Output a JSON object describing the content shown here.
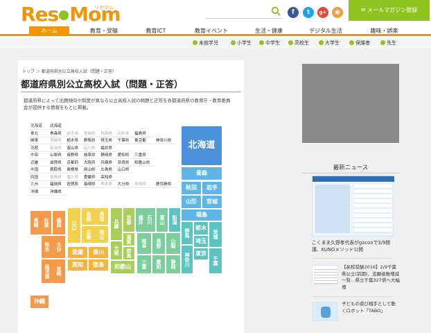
{
  "header": {
    "logo_text": "ResеMom",
    "logo_kana": "リセマム",
    "mail_button": "✉ メールマガジン登録",
    "social": [
      "f",
      "t",
      "g+",
      "rss"
    ]
  },
  "nav": {
    "items": [
      "ホーム",
      "教育・受験",
      "教育ICT",
      "教育イベント",
      "生活・健康",
      "デジタル生活",
      "趣味・娯楽"
    ]
  },
  "subnav": {
    "items": [
      "未就学児",
      "小学生",
      "中学生",
      "高校生",
      "大学生",
      "保護者",
      "先生"
    ]
  },
  "breadcrumb": "トップ ＞ 都道府県別公立高校入試（問題・正答）",
  "page_title": "都道府県別公立高校入試（問題・正答）",
  "description": "都道府県によって出題傾向や制度が異なる公立高校入試の問題と正答を各都道府県の教育庁・教育委員会が提供する情報をもとに掲載。",
  "region_table": [
    {
      "region": "北海道",
      "prefs": [
        {
          "n": "北海道",
          "on": true
        }
      ]
    },
    {
      "region": "東北",
      "prefs": [
        {
          "n": "青森県",
          "on": true
        },
        {
          "n": "岩手県",
          "on": false
        },
        {
          "n": "宮城県",
          "on": false
        },
        {
          "n": "秋田県",
          "on": false
        },
        {
          "n": "山形県",
          "on": false
        },
        {
          "n": "福島県",
          "on": true
        }
      ]
    },
    {
      "region": "関東",
      "prefs": [
        {
          "n": "茨城県",
          "on": false
        },
        {
          "n": "栃木県",
          "on": true
        },
        {
          "n": "群馬県",
          "on": true
        },
        {
          "n": "埼玉県",
          "on": true
        },
        {
          "n": "千葉県",
          "on": true
        },
        {
          "n": "東京都",
          "on": true
        },
        {
          "n": "神奈川県",
          "on": true
        }
      ]
    },
    {
      "region": "北陸",
      "prefs": [
        {
          "n": "新潟県",
          "on": false
        },
        {
          "n": "富山県",
          "on": true
        },
        {
          "n": "石川県",
          "on": false
        },
        {
          "n": "福井県",
          "on": true
        }
      ]
    },
    {
      "region": "中部",
      "prefs": [
        {
          "n": "山梨県",
          "on": true
        },
        {
          "n": "長野県",
          "on": true
        },
        {
          "n": "岐阜県",
          "on": true
        },
        {
          "n": "静岡県",
          "on": true
        },
        {
          "n": "愛知県",
          "on": true
        },
        {
          "n": "三重県",
          "on": true
        }
      ]
    },
    {
      "region": "近畿",
      "prefs": [
        {
          "n": "滋賀県",
          "on": true
        },
        {
          "n": "京都府",
          "on": true
        },
        {
          "n": "大阪府",
          "on": true
        },
        {
          "n": "兵庫県",
          "on": true
        },
        {
          "n": "奈良県",
          "on": true
        },
        {
          "n": "和歌山県",
          "on": true
        }
      ]
    },
    {
      "region": "中国",
      "prefs": [
        {
          "n": "鳥取県",
          "on": true
        },
        {
          "n": "島根県",
          "on": true
        },
        {
          "n": "岡山県",
          "on": true
        },
        {
          "n": "広島県",
          "on": true
        },
        {
          "n": "山口県",
          "on": true
        }
      ]
    },
    {
      "region": "四国",
      "prefs": [
        {
          "n": "徳島県",
          "on": false
        },
        {
          "n": "香川県",
          "on": false
        },
        {
          "n": "愛媛県",
          "on": true
        },
        {
          "n": "高知県",
          "on": true
        }
      ]
    },
    {
      "region": "九州",
      "prefs": [
        {
          "n": "福岡県",
          "on": true
        },
        {
          "n": "佐賀県",
          "on": true
        },
        {
          "n": "長崎県",
          "on": true
        },
        {
          "n": "熊本県",
          "on": false
        },
        {
          "n": "大分県",
          "on": true
        },
        {
          "n": "宮崎県",
          "on": false
        },
        {
          "n": "鹿児島県",
          "on": true
        }
      ]
    },
    {
      "region": "沖縄",
      "prefs": [
        {
          "n": "沖縄県",
          "on": true
        }
      ]
    }
  ],
  "map_prefs": {
    "hokkaido": "北海道",
    "aomori": "青森",
    "akita": "秋田",
    "iwate": "岩手",
    "yamagata": "山形",
    "miyagi": "宮城",
    "fukushima": "福島",
    "niigata": "新潟",
    "gunma": "群馬",
    "tochigi": "栃木",
    "ibaraki": "茨城",
    "saitama": "埼玉",
    "tokyo": "東京",
    "chiba": "千葉",
    "kanagawa": "神奈川",
    "toyama": "富山",
    "ishikawa": "石川",
    "fukui": "福井",
    "nagano": "長野",
    "yamanashi": "山梨",
    "gifu": "岐阜",
    "shizuoka": "静岡",
    "aichi": "愛知",
    "kyoto": "京都",
    "shiga": "滋賀",
    "nara": "奈良",
    "osaka": "大阪",
    "hyogo": "兵庫",
    "mie": "三重",
    "wakayama": "和歌山",
    "shimane": "島根",
    "tottori": "鳥取",
    "hiroshima": "広島",
    "okayama": "岡山",
    "yamaguchi": "山口",
    "ehime": "愛媛",
    "kagawa": "香川",
    "kochi": "高知",
    "tokushima": "徳島",
    "fukuoka": "福岡",
    "saga": "佐賀",
    "nagasaki": "長崎",
    "kumamoto": "熊本",
    "oita": "大分",
    "miyazaki": "宮崎",
    "kagoshima": "鹿児島",
    "okinawa": "沖縄"
  },
  "colors": {
    "brand": "#f29600",
    "hokkaido": "#4a90d9",
    "tohoku": "#5fb5e8",
    "kanto": "#5cc4c0",
    "chubu": "#7ccf9c",
    "kinki": "#a8cf5a",
    "chugoku": "#f2d24a",
    "shikoku": "#f2b43a",
    "kyushu": "#f29a4a"
  },
  "news": {
    "heading": "最新ニュース",
    "items": [
      {
        "text": "こくまま久野孝代表がgacooで3/9開講、KUNOメソッド公開"
      },
      {
        "text": "【高校受験2016】2/9千葉県公立(前期)、志願者数増減一覧…県立千葉327倍へ大幅増"
      },
      {
        "text": "子どもの遊び相手として動くロボット「TABO」"
      }
    ]
  }
}
